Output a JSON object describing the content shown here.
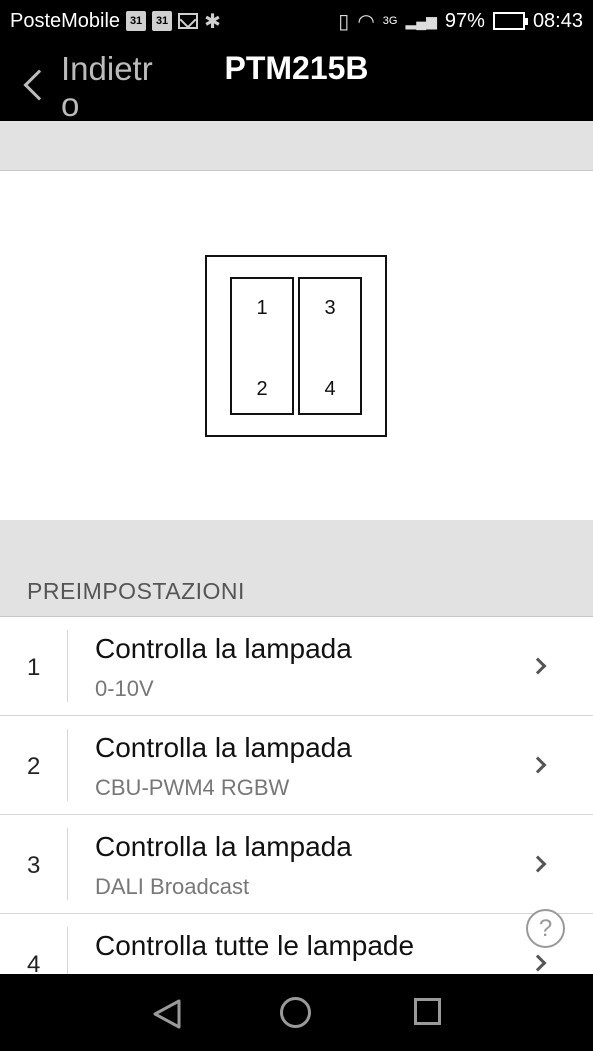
{
  "status_bar": {
    "carrier": "PosteMobile",
    "calendar_day_1": "31",
    "calendar_day_2": "31",
    "network_type": "3G",
    "battery": "97%",
    "time": "08:43"
  },
  "nav": {
    "back_label": "Indietro",
    "title": "PTM215B"
  },
  "switch_diagram": {
    "buttons": [
      "1",
      "2",
      "3",
      "4"
    ]
  },
  "presets": {
    "header": "PREIMPOSTAZIONI",
    "items": [
      {
        "index": "1",
        "title": "Controlla la lampada",
        "subtitle": "0-10V"
      },
      {
        "index": "2",
        "title": "Controlla la lampada",
        "subtitle": "CBU-PWM4 RGBW"
      },
      {
        "index": "3",
        "title": "Controlla la lampada",
        "subtitle": "DALI Broadcast"
      },
      {
        "index": "4",
        "title": "Controlla tutte le lampade",
        "subtitle": ""
      }
    ]
  },
  "help": {
    "label": "?"
  },
  "icons": {
    "back": "chevron-left-icon",
    "item_chevron": "chevron-right-icon",
    "help": "question-circle-icon"
  }
}
